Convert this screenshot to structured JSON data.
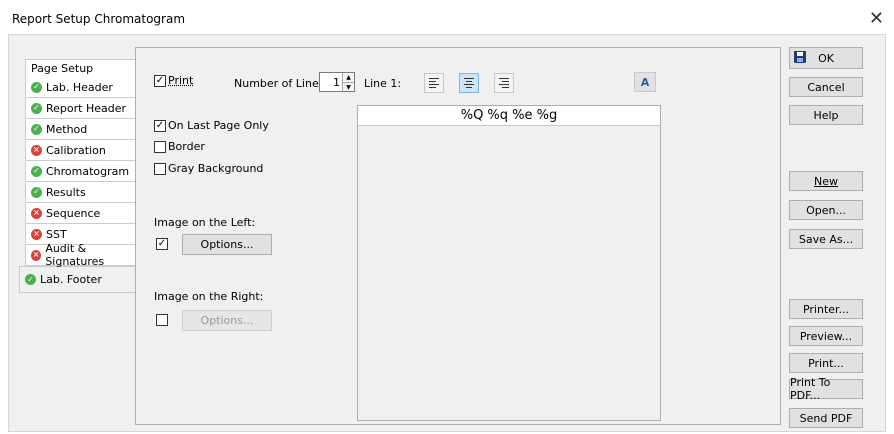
{
  "window": {
    "title": "Report Setup Chromatogram"
  },
  "tabs": {
    "header": "Page Setup",
    "items": [
      {
        "label": "Lab. Header",
        "status": "ok"
      },
      {
        "label": "Report Header",
        "status": "ok"
      },
      {
        "label": "Method",
        "status": "ok"
      },
      {
        "label": "Calibration",
        "status": "error"
      },
      {
        "label": "Chromatogram",
        "status": "ok"
      },
      {
        "label": "Results",
        "status": "ok"
      },
      {
        "label": "Sequence",
        "status": "error"
      },
      {
        "label": "SST",
        "status": "error"
      },
      {
        "label": "Audit & Signatures",
        "status": "error"
      },
      {
        "label": "Lab. Footer",
        "status": "ok"
      }
    ]
  },
  "panel": {
    "print_label": "Print",
    "print_checked": true,
    "number_of_lines_label": "Number of Lines:",
    "number_of_lines_value": "1",
    "line_label": "Line 1:",
    "selected_alignment": "center",
    "font_button_label": "A",
    "on_last_page_label": "On Last Page Only",
    "on_last_page_checked": true,
    "border_label": "Border",
    "border_checked": false,
    "gray_background_label": "Gray Background",
    "gray_background_checked": false,
    "image_left_label": "Image on the Left:",
    "image_left_checked": true,
    "image_left_options": "Options...",
    "image_right_label": "Image on the Right:",
    "image_right_checked": false,
    "image_right_options": "Options...",
    "lines": [
      "%Q %q %e %g"
    ]
  },
  "buttons": {
    "ok": "OK",
    "cancel": "Cancel",
    "help": "Help",
    "new": "New",
    "open": "Open...",
    "save_as": "Save As...",
    "printer": "Printer...",
    "preview": "Preview...",
    "print": "Print...",
    "print_to_pdf": "Print To PDF...",
    "send_pdf": "Send PDF"
  }
}
